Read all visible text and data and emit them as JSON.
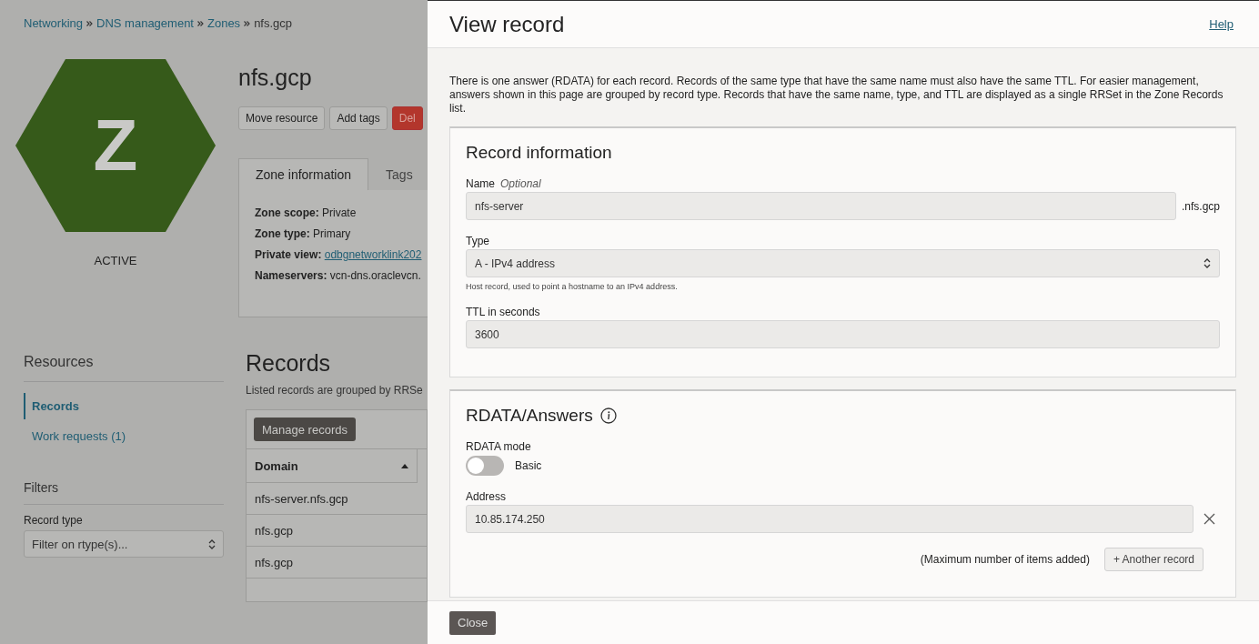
{
  "page": {
    "breadcrumb": [
      {
        "label": "Networking",
        "link": true
      },
      {
        "label": "DNS management",
        "link": true
      },
      {
        "label": "Zones",
        "link": true
      },
      {
        "label": "nfs.gcp",
        "link": false
      }
    ],
    "zone_icon": {
      "letter": "Z",
      "status": "ACTIVE"
    },
    "title": "nfs.gcp",
    "actions": [
      {
        "label": "Move resource",
        "kind": "plain"
      },
      {
        "label": "Add tags",
        "kind": "plain"
      },
      {
        "label": "Del",
        "kind": "danger"
      }
    ],
    "tabs": [
      {
        "label": "Zone information",
        "selected": true
      },
      {
        "label": "Tags",
        "selected": false
      }
    ],
    "zone_info": [
      {
        "key": "Zone scope:",
        "value": "Private",
        "link": false
      },
      {
        "key": "Zone type:",
        "value": "Primary",
        "link": false
      },
      {
        "key": "Private view:",
        "value": "odbgnetworklink202",
        "link": true
      },
      {
        "key": "Nameservers:",
        "value": "vcn-dns.oraclevcn.",
        "link": false
      }
    ],
    "resources": {
      "title": "Resources",
      "items": [
        {
          "label": "Records",
          "selected": true
        },
        {
          "label": "Work requests (1)",
          "selected": false
        }
      ]
    },
    "filters": {
      "title": "Filters",
      "record_type_label": "Record type",
      "record_type_placeholder": "Filter on rtype(s)..."
    },
    "records": {
      "title": "Records",
      "subtitle": "Listed records are grouped by RRSe",
      "manage_button": "Manage records",
      "column": "Domain",
      "rows": [
        "nfs-server.nfs.gcp",
        "nfs.gcp",
        "nfs.gcp"
      ]
    }
  },
  "drawer": {
    "title": "View record",
    "help": "Help",
    "description": "There is one answer (RDATA) for each record. Records of the same type that have the same name must also have the same TTL. For easier management, answers shown in this page are grouped by record type. Records that have the same name, type, and TTL are displayed as a single RRSet in the Zone Records list.",
    "record_information": {
      "title": "Record information",
      "name_label": "Name",
      "name_optional": "Optional",
      "name_value": "nfs-server",
      "name_suffix": ".nfs.gcp",
      "type_label": "Type",
      "type_value": "A - IPv4 address",
      "type_hint": "Host record, used to point a hostname to an IPv4 address.",
      "ttl_label": "TTL in seconds",
      "ttl_value": "3600"
    },
    "rdata": {
      "title": "RDATA/Answers",
      "mode_label": "RDATA mode",
      "mode_on": false,
      "mode_text": "Basic",
      "address_label": "Address",
      "address_value": "10.85.174.250",
      "max_note": "(Maximum number of items added)",
      "another_button": "+ Another record"
    },
    "close_button": "Close"
  }
}
